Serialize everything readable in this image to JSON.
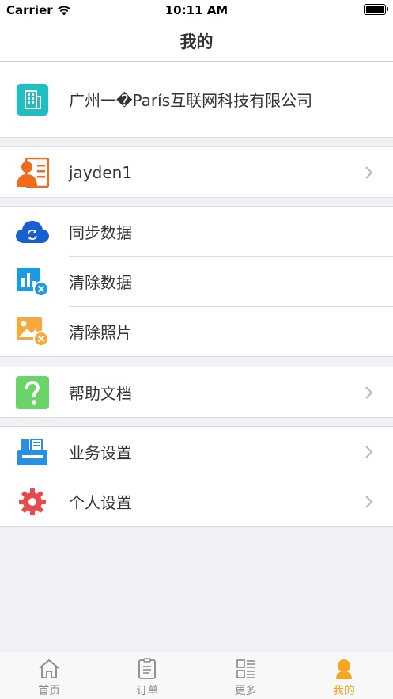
{
  "status_bar": {
    "carrier": "Carrier",
    "time": "10:11 AM"
  },
  "nav": {
    "title": "我的"
  },
  "company": {
    "name": "广州一�París互联网科技有限公司"
  },
  "user": {
    "name": "jayden1"
  },
  "data_section": {
    "items": [
      {
        "label": "同步数据",
        "icon": "cloud-sync-icon"
      },
      {
        "label": "清除数据",
        "icon": "clear-data-icon"
      },
      {
        "label": "清除照片",
        "icon": "clear-photo-icon"
      }
    ]
  },
  "help": {
    "label": "帮助文档"
  },
  "settings_section": {
    "items": [
      {
        "label": "业务设置",
        "icon": "printer-icon"
      },
      {
        "label": "个人设置",
        "icon": "gear-icon"
      }
    ]
  },
  "tabs": [
    {
      "label": "首页",
      "icon": "home-icon",
      "active": false
    },
    {
      "label": "订单",
      "icon": "order-icon",
      "active": false
    },
    {
      "label": "更多",
      "icon": "more-icon",
      "active": false
    },
    {
      "label": "我的",
      "icon": "profile-icon",
      "active": true
    }
  ],
  "colors": {
    "accent": "#f5a623",
    "teal": "#1cc0c0",
    "orange": "#f26b1d",
    "blue": "#1a5fd1",
    "green": "#6ad46a",
    "red": "#e84a4a"
  }
}
